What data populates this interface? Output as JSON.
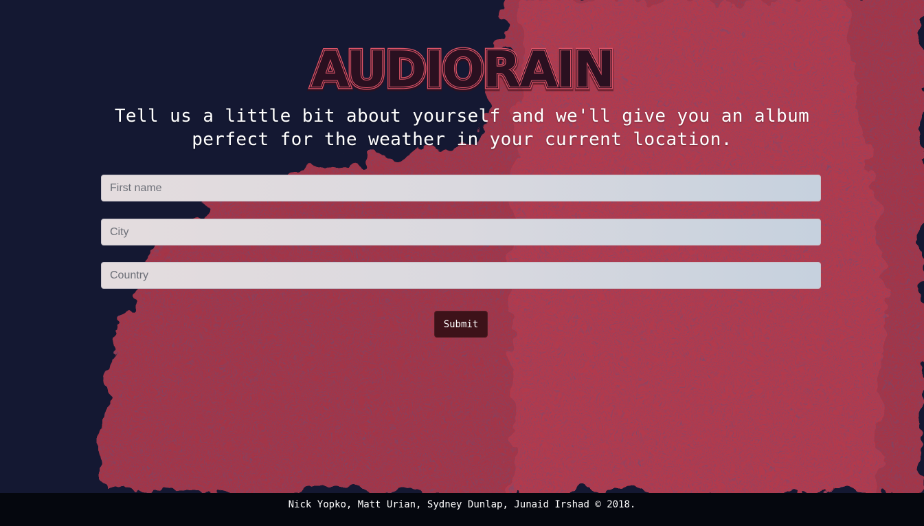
{
  "header": {
    "logo_text": "AUDIORAIN",
    "tagline": "Tell us a little bit about yourself and we'll give you an album perfect for the weather in your current location."
  },
  "form": {
    "first_name": {
      "placeholder": "First name",
      "value": ""
    },
    "city": {
      "placeholder": "City",
      "value": ""
    },
    "country": {
      "placeholder": "Country",
      "value": ""
    },
    "submit_label": "Submit"
  },
  "footer": {
    "credits": "Nick Yopko, Matt Urian, Sydney Dunlap, Junaid Irshad © 2018."
  },
  "colors": {
    "background_navy": "#141832",
    "paint_red": "#b0384a",
    "logo_red": "#e0566a",
    "button_bg": "#3d1219",
    "footer_bg": "#05070e"
  }
}
